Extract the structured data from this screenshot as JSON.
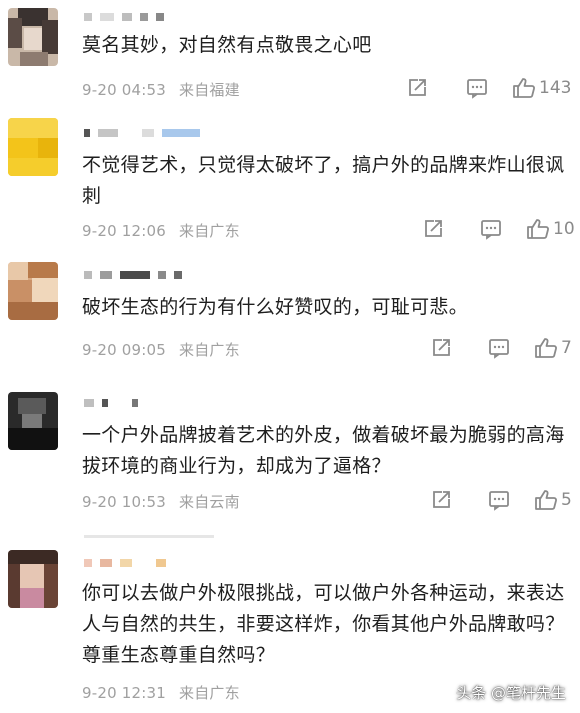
{
  "comments": [
    {
      "text": "莫名其妙，对自然有点敬畏之心吧",
      "time": "9-20 04:53",
      "location": "来自福建",
      "likes": "143"
    },
    {
      "text": "不觉得艺术，只觉得太破坏了，搞户外的品牌来炸山很讽刺",
      "time": "9-20 12:06",
      "location": "来自广东",
      "likes": "10"
    },
    {
      "text": "破坏生态的行为有什么好赞叹的，可耻可悲。",
      "time": "9-20 09:05",
      "location": "来自广东",
      "likes": "7"
    },
    {
      "text": "一个户外品牌披着艺术的外皮，做着破坏最为脆弱的高海拔环境的商业行为，却成为了逼格？",
      "time": "9-20 10:53",
      "location": "来自云南",
      "likes": "5"
    },
    {
      "text": "你可以去做户外极限挑战，可以做户外各种运动，来表达人与自然的共生，非要这样炸，你看其他户外品牌敢吗？尊重生态尊重自然吗？",
      "time": "9-20 12:31",
      "location": "来自广东",
      "likes": ""
    }
  ],
  "icons": {
    "share": "share-icon",
    "comment": "comment-icon",
    "like": "thumbs-up-icon"
  },
  "watermark": "头条 @笔杆先生"
}
